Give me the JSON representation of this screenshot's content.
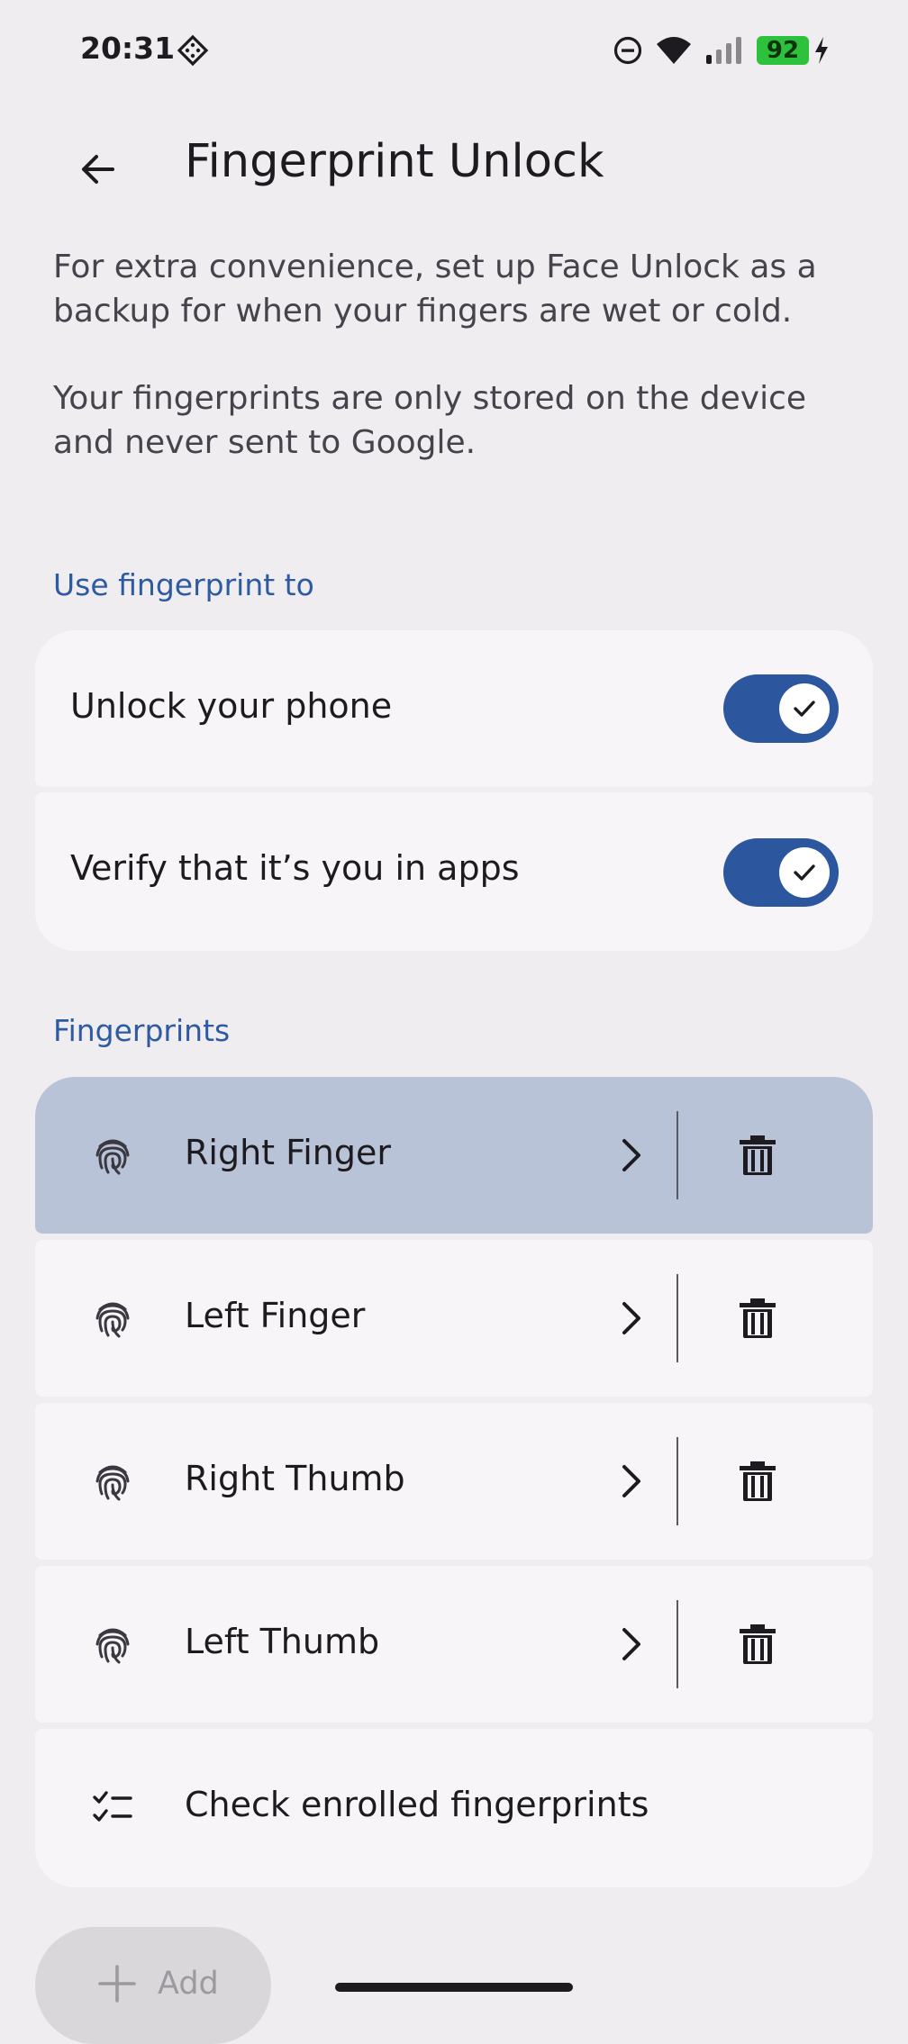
{
  "status_bar": {
    "time": "20:31",
    "battery_level": "92",
    "icons": [
      "diamond-icon",
      "dnd-icon",
      "wifi-icon",
      "signal-icon",
      "battery-icon",
      "charging-icon"
    ]
  },
  "app_bar": {
    "title": "Fingerprint Unlock",
    "back_icon": "arrow-back-icon"
  },
  "intro": {
    "paragraph_1": "For extra convenience, set up Face Unlock as a backup for when your fingers are wet or cold.",
    "paragraph_2": "Your fingerprints are only stored on the device and never sent to Google."
  },
  "use_section": {
    "header": "Use fingerprint to",
    "items": [
      {
        "label": "Unlock your phone",
        "enabled": true
      },
      {
        "label": "Verify that it’s you in apps",
        "enabled": true
      }
    ]
  },
  "fingerprints_section": {
    "header": "Fingerprints",
    "items": [
      {
        "label": "Right Finger",
        "highlighted": true
      },
      {
        "label": "Left Finger",
        "highlighted": false
      },
      {
        "label": "Right Thumb",
        "highlighted": false
      },
      {
        "label": "Left Thumb",
        "highlighted": false
      }
    ],
    "check_label": "Check enrolled fingerprints"
  },
  "fab": {
    "label": "Add"
  },
  "colors": {
    "accent": "#2c569d",
    "highlight_row": "#b9c3d8",
    "card_bg": "#f7f5f7",
    "page_bg": "#efedef",
    "battery": "#2ec23c"
  }
}
